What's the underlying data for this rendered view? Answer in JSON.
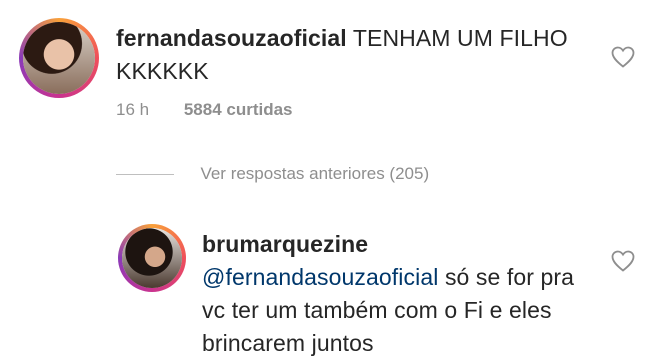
{
  "main_comment": {
    "username": "fernandasouzaoficial",
    "text": "TENHAM UM FILHO KKKKKK",
    "time": "16 h",
    "likes": "5884 curtidas",
    "avatar_icon": "profile-photo",
    "like_icon": "heart-outline-icon"
  },
  "view_replies": {
    "label": "Ver respostas anteriores (205)"
  },
  "reply_comment": {
    "username": "brumarquezine",
    "mention": "@fernandasouzaoficial",
    "text": "só se for pra vc ter um também com o Fi e eles brincarem juntos",
    "avatar_icon": "profile-photo",
    "like_icon": "heart-outline-icon"
  },
  "colors": {
    "username": "#262626",
    "mention": "#00376b",
    "meta": "#8e8e8e",
    "background": "#ffffff"
  }
}
